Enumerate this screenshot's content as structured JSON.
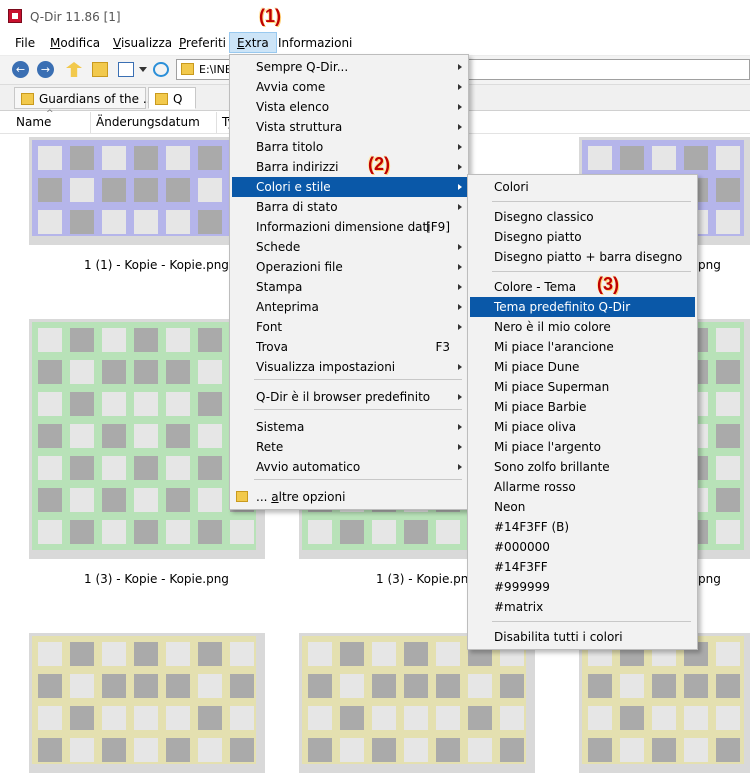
{
  "window": {
    "title": "Q-Dir 11.86 [1]"
  },
  "annotations": {
    "step1": "(1)",
    "step2": "(2)",
    "step3": "(3)"
  },
  "menubar": {
    "items": [
      {
        "label": "File"
      },
      {
        "label": "Modifica"
      },
      {
        "label": "Visualizza"
      },
      {
        "label": "Preferiti"
      },
      {
        "label": "Extra"
      },
      {
        "label": "Informazioni"
      }
    ]
  },
  "toolbar": {
    "icons": [
      "back-icon",
      "forward-icon",
      "up-folder-icon",
      "new-folder-icon",
      "view-mode-icon",
      "refresh-icon"
    ],
    "address": "E:\\INE"
  },
  "tabs": [
    {
      "label": "Guardians of the ..."
    },
    {
      "label": "Q"
    }
  ],
  "columns": [
    {
      "label": "Name"
    },
    {
      "label": "Änderungsdatum"
    },
    {
      "label": "Ty"
    }
  ],
  "files": [
    {
      "caption": "1 (1) - Kopie - Kopie.png",
      "color": "#b5b5ea"
    },
    {
      "caption": "1 (3) - Kopie - Kopie.png",
      "color": "#b8e2b8"
    },
    {
      "caption": "1 (3) - Kopie.png",
      "color": "#b8e2b8"
    },
    {
      "caption": "png",
      "color": "#b5b5ea"
    },
    {
      "caption": "png",
      "color": "#b8e2b8"
    },
    {
      "caption": "",
      "color": "#e4e0b0"
    }
  ],
  "extra_menu": {
    "items": [
      {
        "label": "Sempre Q-Dir...",
        "arrow": true
      },
      {
        "label": "Avvia come",
        "arrow": true
      },
      {
        "label": "Vista elenco",
        "arrow": true
      },
      {
        "label": "Vista struttura",
        "arrow": true
      },
      {
        "label": "Barra titolo",
        "arrow": true
      },
      {
        "label": "Barra indirizzi",
        "arrow": true
      },
      {
        "label": "Colori e stile",
        "arrow": true
      },
      {
        "label": "Barra di stato",
        "arrow": true
      },
      {
        "label": "Informazioni dimensione dati",
        "shortcut": "[F9]"
      },
      {
        "label": "Schede",
        "arrow": true
      },
      {
        "label": "Operazioni file",
        "arrow": true
      },
      {
        "label": "Stampa",
        "arrow": true
      },
      {
        "label": "Anteprima",
        "arrow": true
      },
      {
        "label": "Font",
        "arrow": true
      },
      {
        "label": "Trova",
        "shortcut": "F3"
      },
      {
        "label": "Visualizza impostazioni",
        "arrow": true
      },
      {
        "label": "Q-Dir è il browser predefinito",
        "arrow": true
      },
      {
        "label": "Sistema",
        "arrow": true
      },
      {
        "label": "Rete",
        "arrow": true
      },
      {
        "label": "Avvio automatico",
        "arrow": true
      },
      {
        "label": "... altre opzioni"
      }
    ]
  },
  "colors_menu": {
    "items": [
      {
        "label": "Colori"
      },
      {
        "label": "Disegno classico"
      },
      {
        "label": "Disegno piatto"
      },
      {
        "label": "Disegno piatto + barra disegno"
      },
      {
        "label": "Colore - Tema"
      },
      {
        "label": "Tema predefinito Q-Dir"
      },
      {
        "label": "Nero è il mio colore"
      },
      {
        "label": "Mi piace l'arancione"
      },
      {
        "label": "Mi piace Dune"
      },
      {
        "label": "Mi piace Superman"
      },
      {
        "label": "Mi piace Barbie"
      },
      {
        "label": "Mi piace oliva"
      },
      {
        "label": "Mi piace l'argento"
      },
      {
        "label": "Sono zolfo brillante"
      },
      {
        "label": "Allarme rosso"
      },
      {
        "label": "Neon"
      },
      {
        "label": "#14F3FF (B)"
      },
      {
        "label": "#000000"
      },
      {
        "label": "#14F3FF"
      },
      {
        "label": "#999999"
      },
      {
        "label": "#matrix"
      },
      {
        "label": "Disabilita tutti i colori"
      }
    ]
  },
  "colors": {
    "selection": "#0a58a8",
    "annotation": "#c00000",
    "cell_dark": "#aaaaaa",
    "cell_light": "#e6e6e6"
  }
}
